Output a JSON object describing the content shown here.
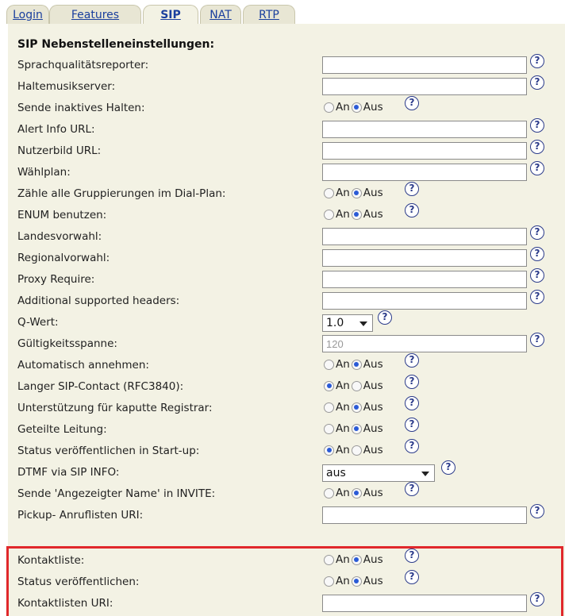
{
  "tabs": [
    {
      "label": "Login",
      "active": false
    },
    {
      "label": "Features",
      "active": false
    },
    {
      "label": "SIP",
      "active": true
    },
    {
      "label": "NAT",
      "active": false
    },
    {
      "label": "RTP",
      "active": false
    }
  ],
  "section_title": "SIP Nebenstelleneinstellungen:",
  "help_glyph": "?",
  "radio_labels": {
    "on": "An",
    "off": "Aus"
  },
  "rows": [
    {
      "label": "Sprachqualitätsreporter:",
      "type": "text",
      "value": ""
    },
    {
      "label": "Haltemusikserver:",
      "type": "text",
      "value": ""
    },
    {
      "label": "Sende inaktives Halten:",
      "type": "radio",
      "selected": "Aus"
    },
    {
      "label": "Alert Info URL:",
      "type": "text",
      "value": ""
    },
    {
      "label": "Nutzerbild URL:",
      "type": "text",
      "value": ""
    },
    {
      "label": "Wählplan:",
      "type": "text",
      "value": ""
    },
    {
      "label": "Zähle alle Gruppierungen im Dial-Plan:",
      "type": "radio",
      "selected": "Aus"
    },
    {
      "label": "ENUM benutzen:",
      "type": "radio",
      "selected": "Aus"
    },
    {
      "label": "Landesvorwahl:",
      "type": "text",
      "value": ""
    },
    {
      "label": "Regionalvorwahl:",
      "type": "text",
      "value": ""
    },
    {
      "label": "Proxy Require:",
      "type": "text",
      "value": ""
    },
    {
      "label": "Additional supported headers:",
      "type": "text",
      "value": ""
    },
    {
      "label": "Q-Wert:",
      "type": "select",
      "value": "1.0"
    },
    {
      "label": "Gültigkeitsspanne:",
      "type": "text",
      "value": "120"
    },
    {
      "label": "Automatisch annehmen:",
      "type": "radio",
      "selected": "Aus"
    },
    {
      "label": "Langer SIP-Contact (RFC3840):",
      "type": "radio",
      "selected": "An"
    },
    {
      "label": "Unterstützung für kaputte Registrar:",
      "type": "radio",
      "selected": "Aus"
    },
    {
      "label": "Geteilte Leitung:",
      "type": "radio",
      "selected": "Aus"
    },
    {
      "label": "Status veröffentlichen in Start-up:",
      "type": "radio",
      "selected": "An"
    },
    {
      "label": "DTMF via SIP INFO:",
      "type": "select",
      "value": "aus"
    },
    {
      "label": "Sende 'Angezeigter Name' in INVITE:",
      "type": "radio",
      "selected": "Aus"
    },
    {
      "label": "Pickup- Anruflisten URI:",
      "type": "text",
      "value": ""
    },
    {
      "label": "Kontaktliste:",
      "type": "radio",
      "selected": "Aus"
    },
    {
      "label": "Status veröffentlichen:",
      "type": "radio",
      "selected": "Aus"
    },
    {
      "label": "Kontaktlisten URI:",
      "type": "text",
      "value": ""
    }
  ],
  "highlight_color": "#e0282b",
  "panel_color": "#f3f2e4",
  "link_color": "#1a3f9e"
}
